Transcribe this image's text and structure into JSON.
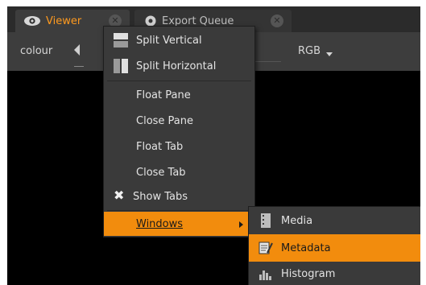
{
  "tabs": [
    {
      "label": "Viewer",
      "icon": "eye-icon",
      "active": true
    },
    {
      "label": "Export Queue",
      "icon": "gear-icon",
      "active": false
    }
  ],
  "toolbar": {
    "channel_label": "colour",
    "channel_mode": "RGB"
  },
  "menu": {
    "items": [
      {
        "label": "Split Vertical",
        "icon": "split-vertical-icon"
      },
      {
        "label": "Split Horizontal",
        "icon": "split-horizontal-icon"
      },
      {
        "label": "Float Pane"
      },
      {
        "label": "Close Pane"
      },
      {
        "label": "Float Tab"
      },
      {
        "label": "Close Tab"
      },
      {
        "label": "Show Tabs",
        "icon": "x-check-icon",
        "checked": true
      },
      {
        "label": "Windows",
        "has_submenu": true,
        "highlighted": true
      }
    ]
  },
  "submenu": {
    "items": [
      {
        "label": "Media",
        "icon": "film-icon"
      },
      {
        "label": "Metadata",
        "icon": "metadata-icon",
        "highlighted": true
      },
      {
        "label": "Histogram",
        "icon": "histogram-icon"
      }
    ]
  },
  "colors": {
    "accent": "#f28c0d",
    "active_tab_text": "#ff9a1f",
    "menu_bg": "#3a3a3a",
    "viewer_bg": "#000000"
  }
}
